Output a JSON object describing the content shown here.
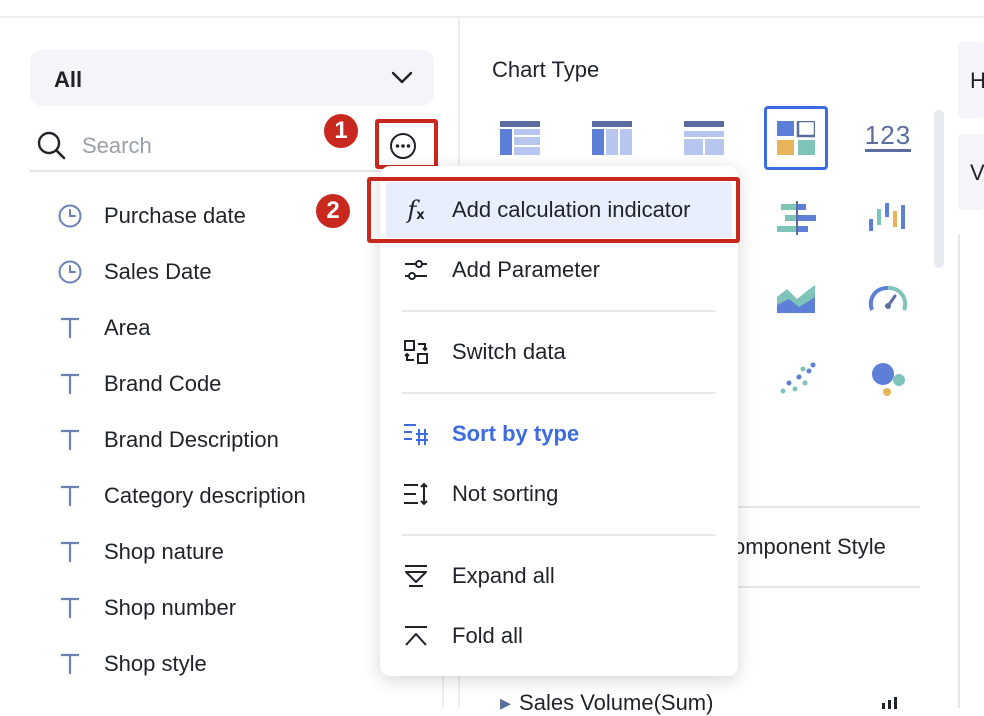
{
  "left": {
    "dropdown_value": "All",
    "search_placeholder": "Search",
    "fields": [
      {
        "label": "Purchase date",
        "icon": "clock-icon"
      },
      {
        "label": "Sales Date",
        "icon": "clock-icon"
      },
      {
        "label": "Area",
        "icon": "text-type-icon"
      },
      {
        "label": "Brand Code",
        "icon": "text-type-icon"
      },
      {
        "label": "Brand Description",
        "icon": "text-type-icon"
      },
      {
        "label": "Category description",
        "icon": "text-type-icon"
      },
      {
        "label": "Shop nature",
        "icon": "text-type-icon"
      },
      {
        "label": "Shop number",
        "icon": "text-type-icon"
      },
      {
        "label": "Shop style",
        "icon": "text-type-icon"
      }
    ]
  },
  "steps": {
    "one": "1",
    "two": "2"
  },
  "menu": {
    "items": [
      {
        "label": "Add calculation indicator",
        "icon": "fx-icon"
      },
      {
        "label": "Add Parameter",
        "icon": "sliders-icon"
      },
      {
        "label": "Switch data",
        "icon": "switch-data-icon"
      },
      {
        "label": "Sort by type",
        "icon": "sort-by-type-icon",
        "active": true
      },
      {
        "label": "Not sorting",
        "icon": "not-sorting-icon"
      },
      {
        "label": "Expand all",
        "icon": "expand-all-icon"
      },
      {
        "label": "Fold all",
        "icon": "fold-all-icon"
      }
    ]
  },
  "right": {
    "chart_type_title": "Chart Type",
    "number_chart_label": "123",
    "component_style_partial": "omponent Style",
    "bottom_partial": "Sales Volume(Sum)",
    "far_right_1": "H",
    "far_right_2": "V"
  },
  "colors": {
    "accent": "#3d6be0",
    "annotation_red": "#c8281e",
    "field_icon": "#6b7fb8",
    "menu_highlight": "#e8eefb"
  }
}
